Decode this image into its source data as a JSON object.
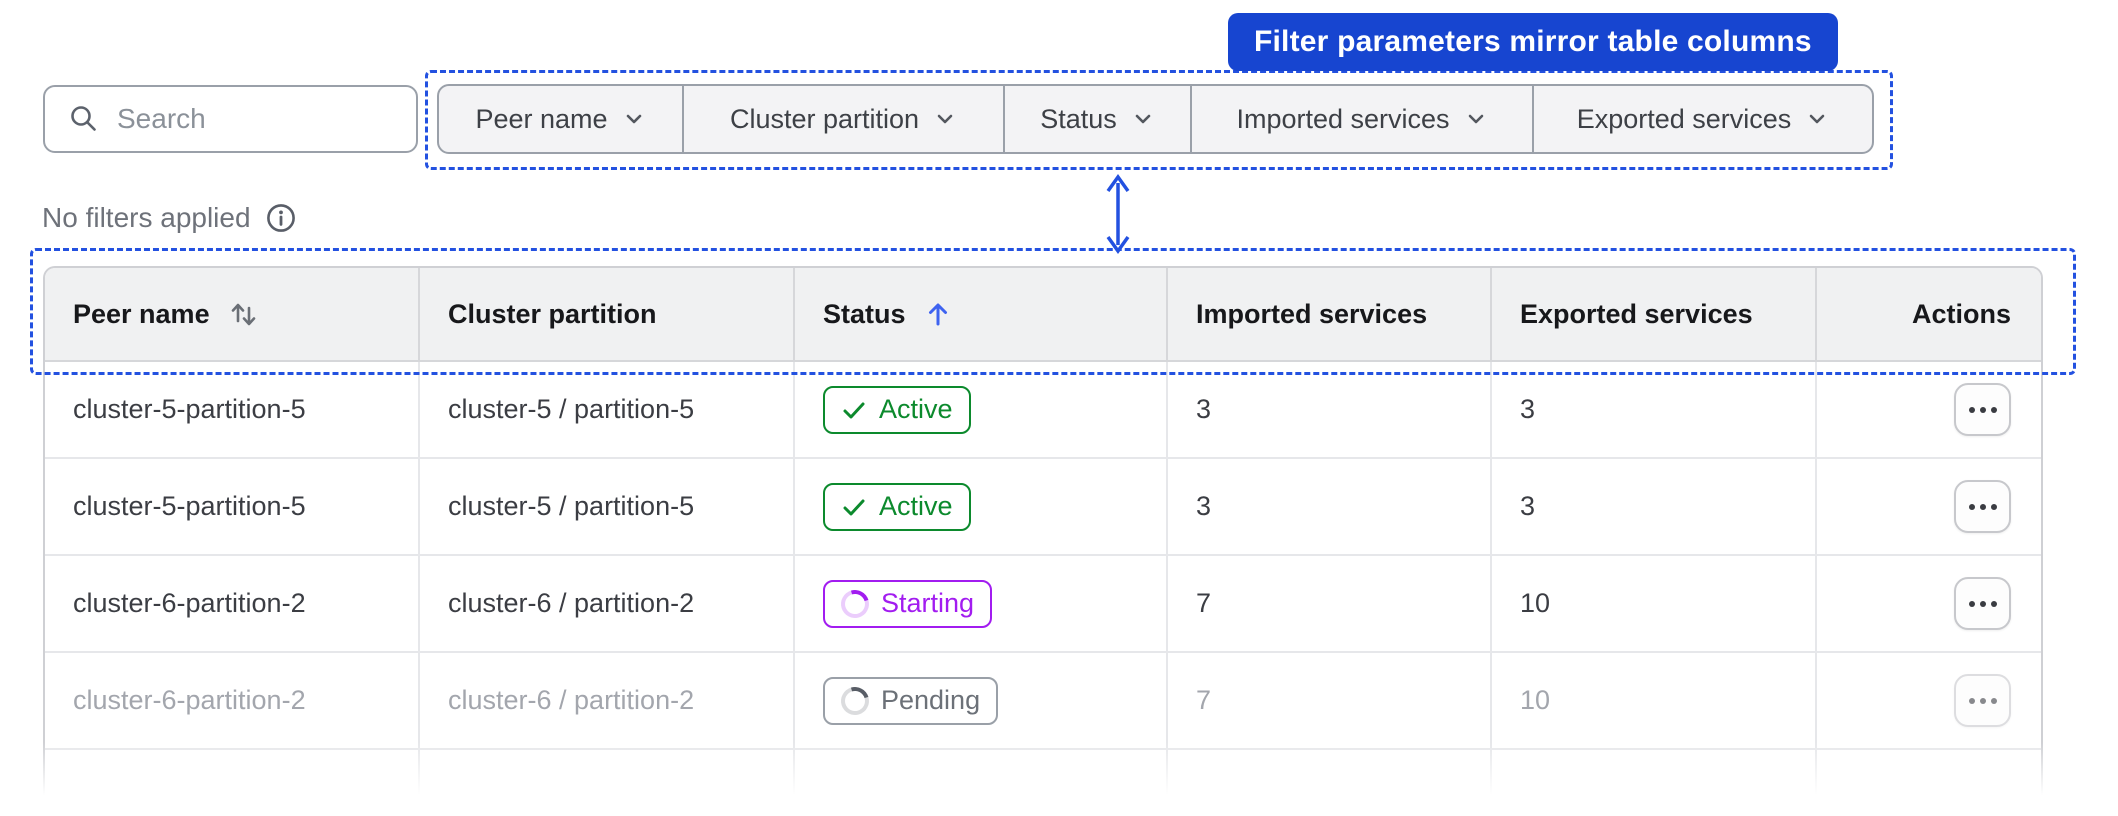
{
  "annotation": {
    "banner": "Filter parameters mirror table columns",
    "accent": "#1745d0"
  },
  "toolbar": {
    "search_placeholder": "Search",
    "filters": [
      {
        "label": "Peer name"
      },
      {
        "label": "Cluster partition"
      },
      {
        "label": "Status"
      },
      {
        "label": "Imported services"
      },
      {
        "label": "Exported services"
      }
    ],
    "filter_status": "No filters applied"
  },
  "table": {
    "columns": [
      {
        "label": "Peer name",
        "sort": "sortable"
      },
      {
        "label": "Cluster partition",
        "sort": "none"
      },
      {
        "label": "Status",
        "sort": "ascending"
      },
      {
        "label": "Imported services",
        "sort": "none"
      },
      {
        "label": "Exported services",
        "sort": "none"
      },
      {
        "label": "Actions",
        "sort": "none"
      }
    ],
    "rows": [
      {
        "peer_name": "cluster-5-partition-5",
        "cluster_partition": "cluster-5 / partition-5",
        "status": "Active",
        "imported_services": "3",
        "exported_services": "3"
      },
      {
        "peer_name": "cluster-5-partition-5",
        "cluster_partition": "cluster-5 / partition-5",
        "status": "Active",
        "imported_services": "3",
        "exported_services": "3"
      },
      {
        "peer_name": "cluster-6-partition-2",
        "cluster_partition": "cluster-6 / partition-2",
        "status": "Starting",
        "imported_services": "7",
        "exported_services": "10"
      },
      {
        "peer_name": "cluster-6-partition-2",
        "cluster_partition": "cluster-6 / partition-2",
        "status": "Pending",
        "imported_services": "7",
        "exported_services": "10"
      }
    ],
    "status_colors": {
      "active": "#0c8a2d",
      "starting": "#a21cf0",
      "pending": "#6c7178"
    }
  }
}
